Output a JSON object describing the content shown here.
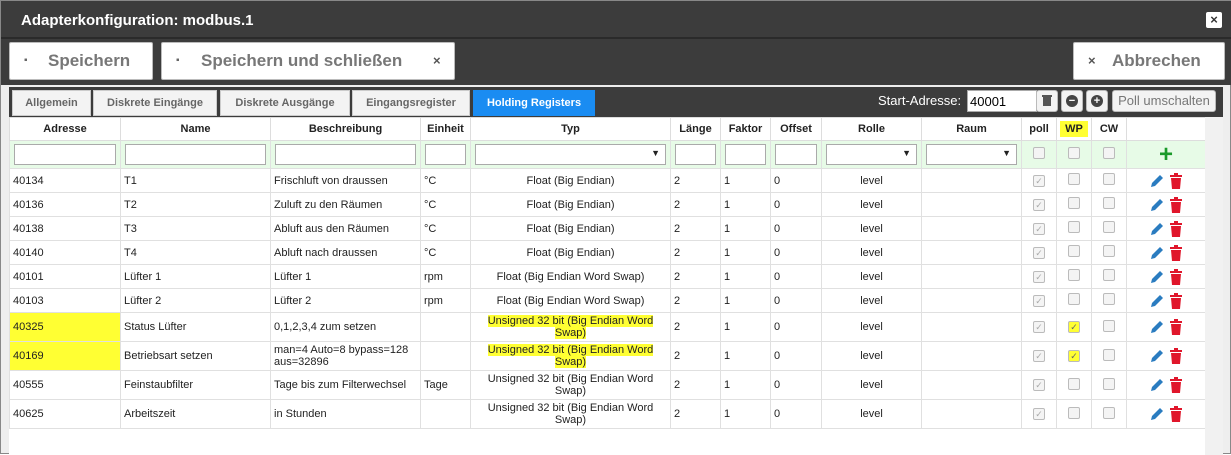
{
  "window": {
    "title": "Adapterkonfiguration: modbus.1",
    "close": "×"
  },
  "toolbar": {
    "save": "Speichern",
    "save_close": "Speichern und schließen",
    "save_close_x": "×",
    "cancel": "Abbrechen",
    "cancel_x": "×"
  },
  "tabs": [
    {
      "label": "Allgemein",
      "active": false
    },
    {
      "label": "Diskrete Eingänge",
      "active": false
    },
    {
      "label": "Diskrete Ausgänge",
      "active": false
    },
    {
      "label": "Eingangsregister",
      "active": false
    },
    {
      "label": "Holding Registers",
      "active": true
    }
  ],
  "start": {
    "label": "Start-Adresse:",
    "value": "40001",
    "poll_button": "Poll umschalten"
  },
  "columns": [
    "Adresse",
    "Name",
    "Beschreibung",
    "Einheit",
    "Typ",
    "Länge",
    "Faktor",
    "Offset",
    "Rolle",
    "Raum",
    "poll",
    "WP",
    "CW"
  ],
  "rows": [
    {
      "adresse": "40134",
      "name": "T1",
      "beschreibung": "Frischluft von draussen",
      "einheit": "°C",
      "typ": "Float (Big Endian)",
      "laenge": "2",
      "faktor": "1",
      "offset": "0",
      "rolle": "level",
      "poll": true,
      "wp": false,
      "cw": false
    },
    {
      "adresse": "40136",
      "name": "T2",
      "beschreibung": "Zuluft zu den Räumen",
      "einheit": "°C",
      "typ": "Float (Big Endian)",
      "laenge": "2",
      "faktor": "1",
      "offset": "0",
      "rolle": "level",
      "poll": true,
      "wp": false,
      "cw": false
    },
    {
      "adresse": "40138",
      "name": "T3",
      "beschreibung": "Abluft aus den Räumen",
      "einheit": "°C",
      "typ": "Float (Big Endian)",
      "laenge": "2",
      "faktor": "1",
      "offset": "0",
      "rolle": "level",
      "poll": true,
      "wp": false,
      "cw": false
    },
    {
      "adresse": "40140",
      "name": "T4",
      "beschreibung": "Abluft nach draussen",
      "einheit": "°C",
      "typ": "Float (Big Endian)",
      "laenge": "2",
      "faktor": "1",
      "offset": "0",
      "rolle": "level",
      "poll": true,
      "wp": false,
      "cw": false
    },
    {
      "adresse": "40101",
      "name": "Lüfter 1",
      "beschreibung": "Lüfter 1",
      "einheit": "rpm",
      "typ": "Float (Big Endian Word Swap)",
      "laenge": "2",
      "faktor": "1",
      "offset": "0",
      "rolle": "level",
      "poll": true,
      "wp": false,
      "cw": false
    },
    {
      "adresse": "40103",
      "name": "Lüfter 2",
      "beschreibung": "Lüfter 2",
      "einheit": "rpm",
      "typ": "Float (Big Endian Word Swap)",
      "laenge": "2",
      "faktor": "1",
      "offset": "0",
      "rolle": "level",
      "poll": true,
      "wp": false,
      "cw": false
    },
    {
      "adresse": "40325",
      "name": "Status Lüfter",
      "beschreibung": "0,1,2,3,4 zum setzen",
      "einheit": "",
      "typ": "Unsigned 32 bit (Big Endian Word Swap)",
      "laenge": "2",
      "faktor": "1",
      "offset": "0",
      "rolle": "level",
      "poll": true,
      "wp": true,
      "cw": false,
      "highlight": true
    },
    {
      "adresse": "40169",
      "name": "Betriebsart setzen",
      "beschreibung": "man=4 Auto=8 bypass=128 aus=32896",
      "einheit": "",
      "typ": "Unsigned 32 bit (Big Endian Word Swap)",
      "laenge": "2",
      "faktor": "1",
      "offset": "0",
      "rolle": "level",
      "poll": true,
      "wp": true,
      "cw": false,
      "highlight": true
    },
    {
      "adresse": "40555",
      "name": "Feinstaubfilter",
      "beschreibung": "Tage bis zum Filterwechsel",
      "einheit": "Tage",
      "typ": "Unsigned 32 bit (Big Endian Word Swap)",
      "laenge": "2",
      "faktor": "1",
      "offset": "0",
      "rolle": "level",
      "poll": true,
      "wp": false,
      "cw": false
    },
    {
      "adresse": "40625",
      "name": "Arbeitszeit",
      "beschreibung": "in Stunden",
      "einheit": "",
      "typ": "Unsigned 32 bit (Big Endian Word Swap)",
      "laenge": "2",
      "faktor": "1",
      "offset": "0",
      "rolle": "level",
      "poll": true,
      "wp": false,
      "cw": false
    }
  ],
  "icons": {
    "edit": "pencil-icon",
    "delete": "trash-icon",
    "add": "plus-icon",
    "save": "floppy-icon",
    "close": "times-icon"
  },
  "colors": {
    "header": "#3c3c3c",
    "active_tab": "#1a8cf2",
    "highlight": "#ffff33",
    "filter_row": "#e7fbe7",
    "delete": "#e0162b",
    "edit": "#2a7cc0",
    "add": "#1a9a2a"
  }
}
